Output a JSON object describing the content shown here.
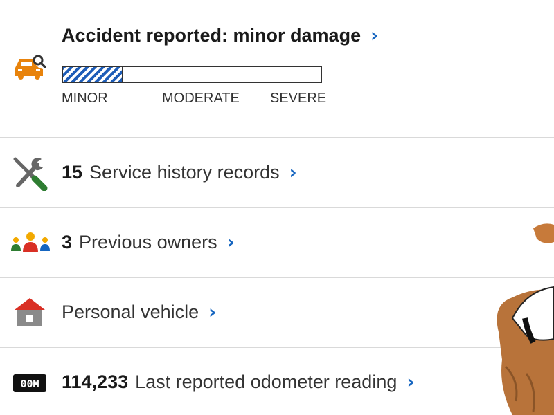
{
  "accident": {
    "title": "Accident reported: minor damage",
    "severity_fraction": 0.235,
    "scale": {
      "minor": "MINOR",
      "moderate": "MODERATE",
      "severe": "SEVERE"
    }
  },
  "service": {
    "count": "15",
    "label": "Service history records"
  },
  "owners": {
    "count": "3",
    "label": "Previous owners"
  },
  "usage": {
    "label": "Personal vehicle"
  },
  "odometer": {
    "reading": "114,233",
    "label": "Last reported odometer reading",
    "icon_text": "00M"
  },
  "chevron": "›",
  "colors": {
    "accent": "#1565c0",
    "car_icon": "#e8830c",
    "meter_hatch": "#1e5db8",
    "house_roof": "#d93025",
    "wrench_handle": "#2e7d32"
  }
}
